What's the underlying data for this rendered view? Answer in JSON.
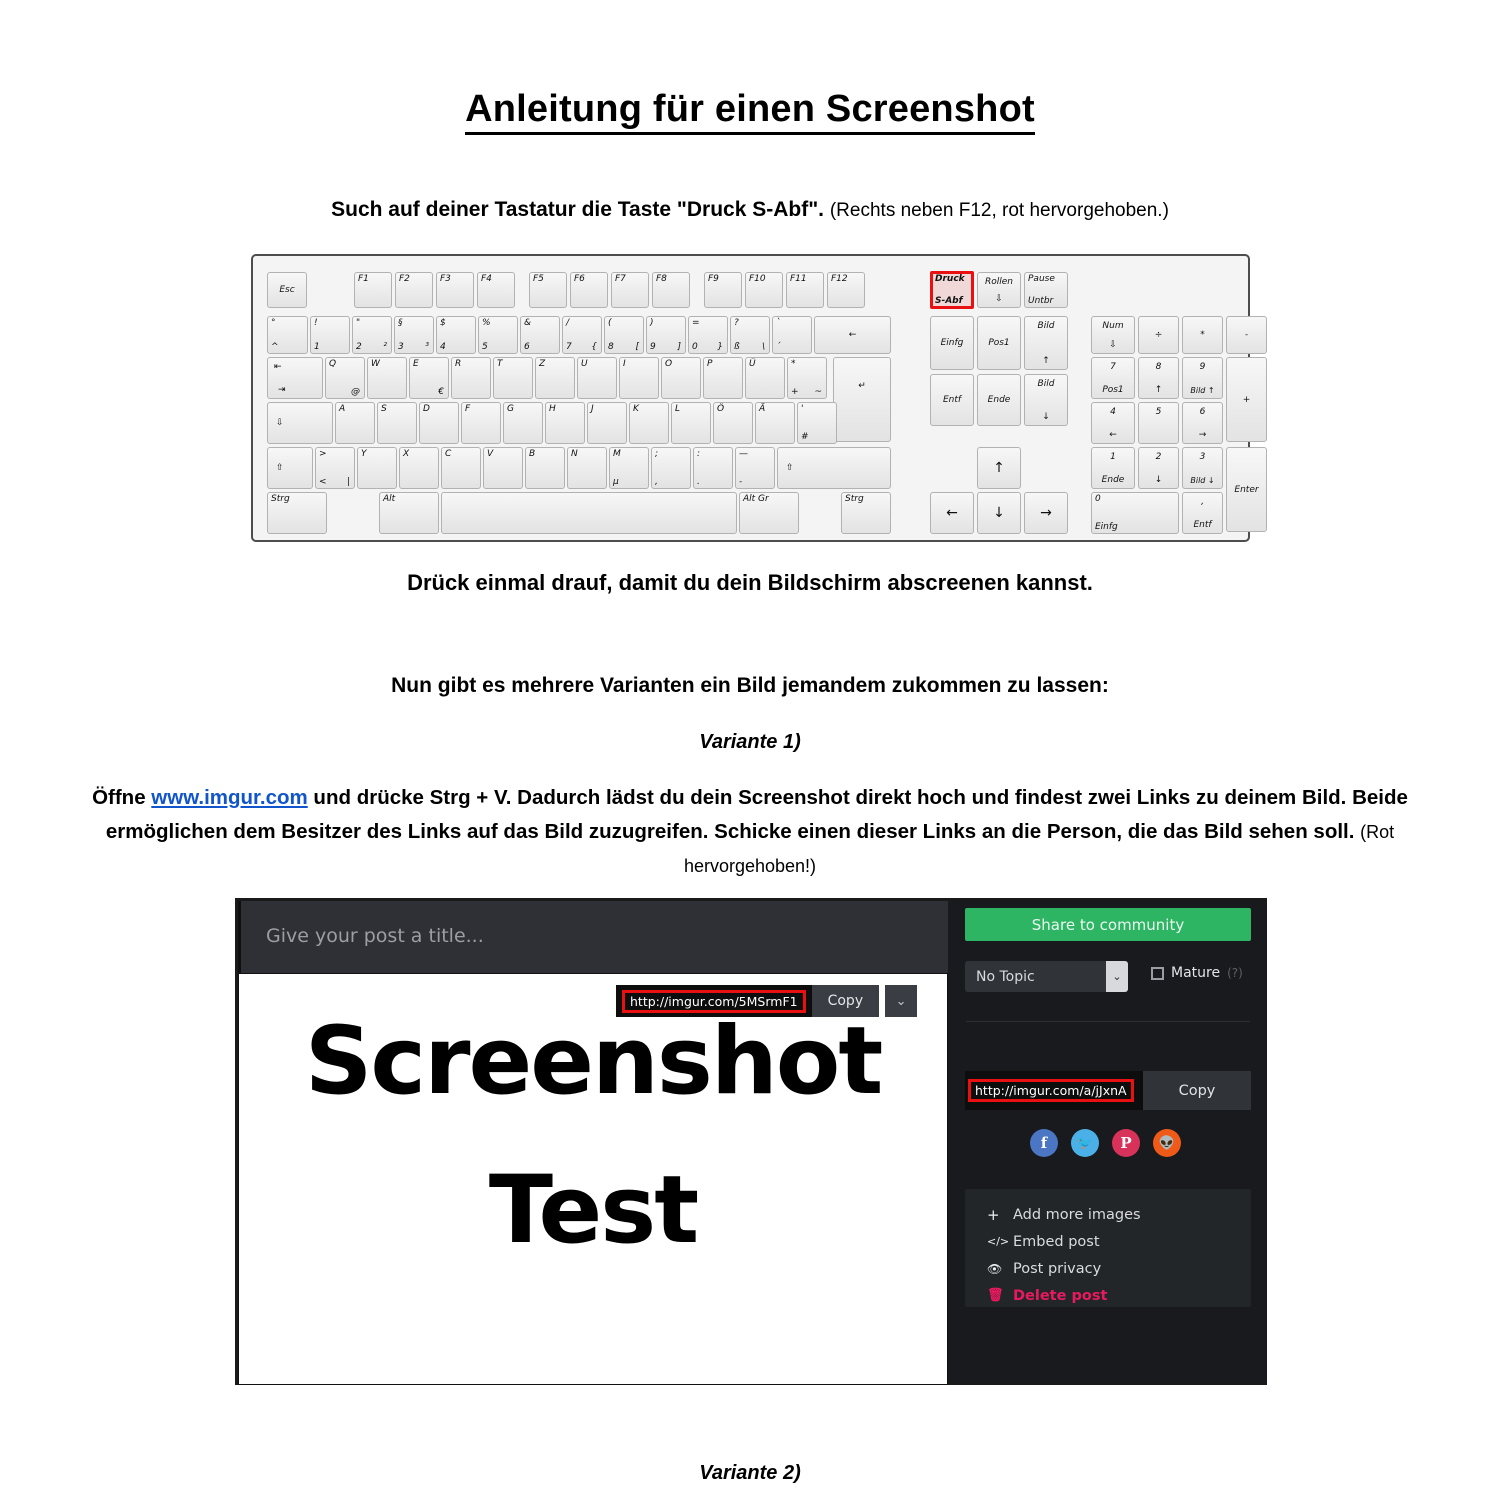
{
  "document": {
    "title": "Anleitung für einen Screenshot",
    "step1_bold": "Such auf deiner Tastatur die Taste \"Druck S-Abf\".",
    "step1_note": "(Rechts neben F12, rot hervorgehoben.)",
    "step2": "Drück einmal drauf, damit du dein Bildschirm abscreenen kannst.",
    "step3": "Nun gibt es mehrere Varianten ein Bild jemandem zukommen zu lassen:",
    "variant1_heading": "Variante 1)",
    "variant1_text_a": "Öffne ",
    "variant1_link": "www.imgur.com",
    "variant1_text_b": " und drücke Strg + V. Dadurch lädst du dein Screenshot direkt hoch und findest zwei Links zu deinem Bild. Beide ermöglichen dem Besitzer des Links auf das Bild zuzugreifen. Schicke einen dieser Links an die Person, die das Bild sehen soll. ",
    "variant1_note": "(Rot hervorgehoben!)",
    "variant2_heading": "Variante 2)",
    "link_color": "#1155cc"
  },
  "keyboard": {
    "highlight_key": "Druck S-Abf",
    "highlight_color": "#e81010",
    "keys": {
      "esc": "Esc",
      "f1": "F1",
      "f2": "F2",
      "f3": "F3",
      "f4": "F4",
      "f5": "F5",
      "f6": "F6",
      "f7": "F7",
      "f8": "F8",
      "f9": "F9",
      "f10": "F10",
      "f11": "F11",
      "f12": "F12",
      "druck_top": "Druck",
      "druck_bottom": "S-Abf",
      "rollen": "Rollen",
      "pause_top": "Pause",
      "pause_bottom": "Untbr",
      "circ_top": "°",
      "circ_bottom": "^",
      "n1_top": "!",
      "n1_bottom": "1",
      "n2_top": "\"",
      "n2_bottom": "2",
      "n2_alt": "²",
      "n3_top": "§",
      "n3_bottom": "3",
      "n3_alt": "³",
      "n4_top": "$",
      "n4_bottom": "4",
      "n5_top": "%",
      "n5_bottom": "5",
      "n6_top": "&",
      "n6_bottom": "6",
      "n7_top": "/",
      "n7_bottom": "7",
      "n7_alt": "{",
      "n8_top": "(",
      "n8_bottom": "8",
      "n8_alt": "[",
      "n9_top": ")",
      "n9_bottom": "9",
      "n9_alt": "]",
      "n0_top": "=",
      "n0_bottom": "0",
      "n0_alt": "}",
      "ss_top": "?",
      "ss_bottom": "ß",
      "ss_alt": "\\",
      "acc_top": "`",
      "acc_bottom": "´",
      "backspace": "←",
      "tab": "⇤⇥",
      "q": "Q",
      "q_alt": "@",
      "w": "W",
      "e": "E",
      "e_alt": "€",
      "r": "R",
      "t": "T",
      "z": "Z",
      "u": "U",
      "i": "I",
      "o": "O",
      "p": "P",
      "ue": "Ü",
      "plus_top": "*",
      "plus_bottom": "+",
      "plus_alt": "~",
      "enter": "↵",
      "capslock": "⇩",
      "a": "A",
      "s": "S",
      "d": "D",
      "f": "F",
      "g": "G",
      "h": "H",
      "j": "J",
      "k": "K",
      "l": "L",
      "oe": "Ö",
      "ae": "Ä",
      "hash_top": "'",
      "hash_bottom": "#",
      "shift_l": "⇧",
      "lt_top": ">",
      "lt_bottom": "<",
      "lt_alt": "|",
      "y": "Y",
      "x": "X",
      "c": "C",
      "v": "V",
      "b": "B",
      "n": "N",
      "m": "M",
      "m_alt": "µ",
      "comma_top": ";",
      "comma_bottom": ",",
      "dot_top": ":",
      "dot_bottom": ".",
      "minus_top": "—",
      "minus_bottom": "-",
      "shift_r": "⇧",
      "strg_l": "Strg",
      "alt": "Alt",
      "space": "",
      "altgr": "Alt Gr",
      "strg_r": "Strg",
      "einfg": "Einfg",
      "pos1": "Pos1",
      "bild_up_top": "Bild",
      "bild_up_bottom": "↑",
      "entf": "Entf",
      "ende": "Ende",
      "bild_dn_top": "Bild",
      "bild_dn_bottom": "↓",
      "arrow_up": "↑",
      "arrow_left": "←",
      "arrow_down": "↓",
      "arrow_right": "→",
      "num_top": "Num",
      "num_bottom": "⇩",
      "div": "÷",
      "mul": "*",
      "sub": "-",
      "add": "+",
      "np7_top": "7",
      "np7_bottom": "Pos1",
      "np8_top": "8",
      "np8_bottom": "↑",
      "np9_top": "9",
      "np9_bottom": "Bild ↑",
      "np4_top": "4",
      "np4_bottom": "←",
      "np5_top": "5",
      "np5_bottom": "",
      "np6_top": "6",
      "np6_bottom": "→",
      "np1_top": "1",
      "np1_bottom": "Ende",
      "np2_top": "2",
      "np2_bottom": "↓",
      "np3_top": "3",
      "np3_bottom": "Bild ↓",
      "np0_top": "0",
      "np0_bottom": "Einfg",
      "npdot_top": ",",
      "npdot_bottom": "Entf",
      "npenter": "Enter"
    }
  },
  "imgur": {
    "title_placeholder": "Give your post a title...",
    "image_text_line1": "Screenshot",
    "image_text_line2": "Test",
    "direct_url": "http://imgur.com/5MSrmF1",
    "copy_label": "Copy",
    "dropdown_chevron": "⌄",
    "share_button": "Share to community",
    "share_button_color": "#2db563",
    "topic_value": "No Topic",
    "topic_chevron": "⌄",
    "mature_label": "Mature",
    "mature_hint": "(?)",
    "album_url": "http://imgur.com/a/jJxnA",
    "album_copy_label": "Copy",
    "url_highlight_color": "#e81010",
    "socials": [
      {
        "name": "facebook",
        "glyph": "f",
        "color": "#4a76c4"
      },
      {
        "name": "twitter",
        "glyph": "🐦",
        "color": "#4cb0e8"
      },
      {
        "name": "pinterest",
        "glyph": "P",
        "color": "#d8325a"
      },
      {
        "name": "reddit",
        "glyph": "👽",
        "color": "#f05a18"
      }
    ],
    "actions": [
      {
        "name": "add-more-images",
        "icon": "+",
        "label": "Add more images",
        "danger": false
      },
      {
        "name": "embed-post",
        "icon": "</>",
        "label": "Embed post",
        "danger": false
      },
      {
        "name": "post-privacy",
        "icon": "👁",
        "label": "Post privacy",
        "danger": false
      },
      {
        "name": "delete-post",
        "icon": "🗑",
        "label": "Delete post",
        "danger": true
      }
    ]
  }
}
